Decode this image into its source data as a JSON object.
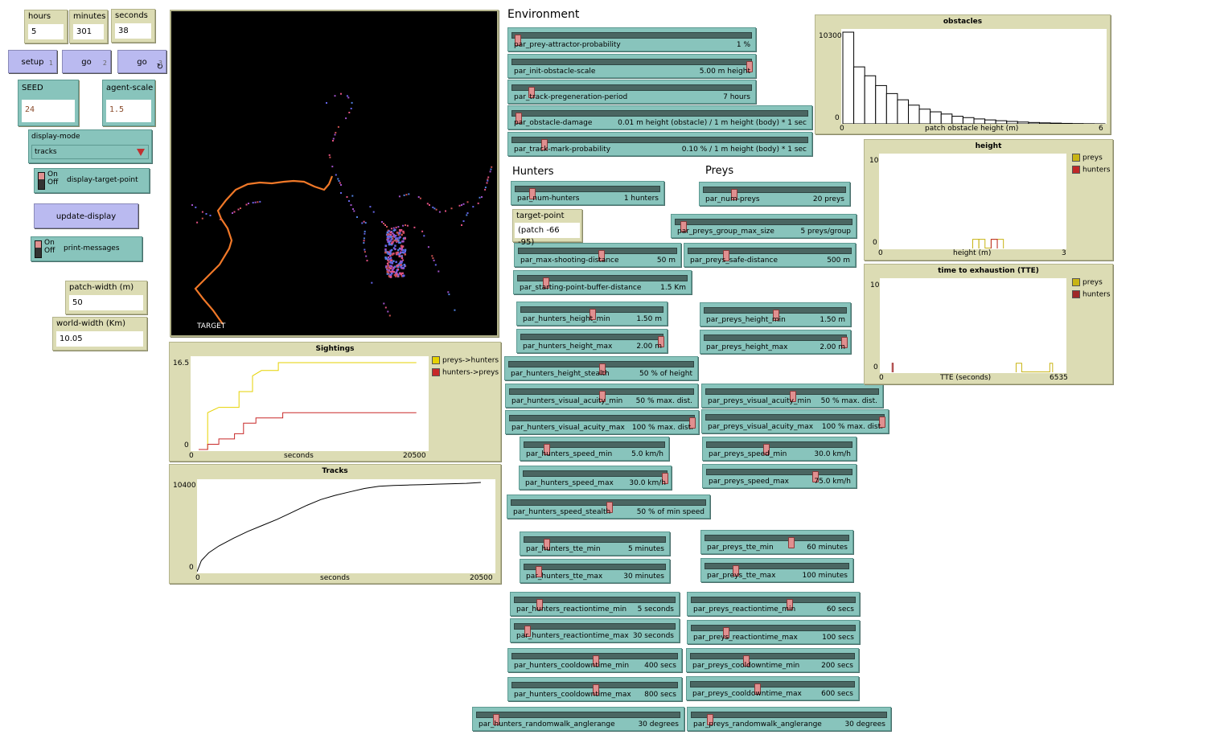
{
  "monitors": {
    "hours": {
      "label": "hours",
      "value": "5"
    },
    "minutes": {
      "label": "minutes",
      "value": "301"
    },
    "seconds": {
      "label": "seconds",
      "value": "38"
    },
    "patch_width": {
      "label": "patch-width (m)",
      "value": "50"
    },
    "world_width": {
      "label": "world-width (Km)",
      "value": "10.05"
    },
    "target_point": {
      "label": "target-point",
      "value": "(patch -66 -95)"
    }
  },
  "buttons": {
    "setup": {
      "label": "setup",
      "key": "1"
    },
    "go_once": {
      "label": "go",
      "key": "2"
    },
    "go_forever": {
      "label": "go",
      "key": "3"
    },
    "update_display": {
      "label": "update-display"
    }
  },
  "inputs": {
    "seed": {
      "label": "SEED",
      "value": "24"
    },
    "agent_scale": {
      "label": "agent-scale",
      "value": "1.5"
    }
  },
  "chooser": {
    "label": "display-mode",
    "value": "tracks"
  },
  "switches": {
    "display_target_point": {
      "label": "display-target-point",
      "on": "On",
      "off": "Off"
    },
    "print_messages": {
      "label": "print-messages",
      "on": "On",
      "off": "Off"
    }
  },
  "sections": {
    "environment": "Environment",
    "hunters": "Hunters",
    "preys": "Preys"
  },
  "view": {
    "target_label": "TARGET"
  },
  "sliders": {
    "prey_attractor": {
      "name": "par_prey-attractor-probability",
      "value": "1 %",
      "fraction": 0.01
    },
    "init_obstacle_scale": {
      "name": "par_init-obstacle-scale",
      "value": "5.00 m height",
      "fraction": 1.0
    },
    "track_pregeneration": {
      "name": "par_track-pregeneration-period",
      "value": "7 hours",
      "fraction": 0.07
    },
    "obstacle_damage": {
      "name": "par_obstacle-damage",
      "value": "0.01 m height (obstacle) / 1 m height (body) * 1 sec",
      "fraction": 0.01
    },
    "track_mark": {
      "name": "par_track-mark-probability",
      "value": "0.10 % / 1 m height (body) * 1 sec",
      "fraction": 0.1
    },
    "num_hunters": {
      "name": "par_num-hunters",
      "value": "1 hunters",
      "fraction": 0.1
    },
    "num_preys": {
      "name": "par_num-preys",
      "value": "20 preys",
      "fraction": 0.2
    },
    "preys_group_max": {
      "name": "par_preys_group_max_size",
      "value": "5 preys/group",
      "fraction": 0.03
    },
    "max_shooting": {
      "name": "par_max-shooting-distance",
      "value": "50 m",
      "fraction": 0.52
    },
    "preys_safe": {
      "name": "par_preys_safe-distance",
      "value": "500 m",
      "fraction": 0.22
    },
    "starting_buffer": {
      "name": "par_starting-point-buffer-distance",
      "value": "1.5 Km",
      "fraction": 0.15
    },
    "h_height_min": {
      "name": "par_hunters_height_min",
      "value": "1.50 m",
      "fraction": 0.5
    },
    "h_height_max": {
      "name": "par_hunters_height_max",
      "value": "2.00 m",
      "fraction": 1.0
    },
    "h_height_stealth": {
      "name": "par_hunters_height_stealth",
      "value": "50 % of height",
      "fraction": 0.5
    },
    "h_visual_min": {
      "name": "par_hunters_visual_acuity_min",
      "value": "50 % max. dist.",
      "fraction": 0.5
    },
    "h_visual_max": {
      "name": "par_hunters_visual_acuity_max",
      "value": "100 % max. dist.",
      "fraction": 1.0
    },
    "h_speed_min": {
      "name": "par_hunters_speed_min",
      "value": "5.0 km/h",
      "fraction": 0.14
    },
    "h_speed_max": {
      "name": "par_hunters_speed_max",
      "value": "30.0 km/h",
      "fraction": 1.0
    },
    "h_speed_stealth": {
      "name": "par_hunters_speed_stealth",
      "value": "50 % of min speed",
      "fraction": 0.5
    },
    "h_tte_min": {
      "name": "par_hunters_tte_min",
      "value": "5 minutes",
      "fraction": 0.14
    },
    "h_tte_max": {
      "name": "par_hunters_tte_max",
      "value": "30 minutes",
      "fraction": 0.08
    },
    "h_react_min": {
      "name": "par_hunters_reactiontime_min",
      "value": "5 seconds",
      "fraction": 0.14
    },
    "h_react_max": {
      "name": "par_hunters_reactiontime_max",
      "value": "30 seconds",
      "fraction": 0.06
    },
    "h_cool_min": {
      "name": "par_hunters_cooldowntime_min",
      "value": "400 secs",
      "fraction": 0.5
    },
    "h_cool_max": {
      "name": "par_hunters_cooldowntime_max",
      "value": "800 secs",
      "fraction": 0.5
    },
    "h_randomwalk": {
      "name": "par_hunters_randomwalk_anglerange",
      "value": "30 degrees",
      "fraction": 0.08
    },
    "p_height_min": {
      "name": "par_preys_height_min",
      "value": "1.50 m",
      "fraction": 0.5
    },
    "p_height_max": {
      "name": "par_preys_height_max",
      "value": "2.00 m",
      "fraction": 1.0
    },
    "p_visual_min": {
      "name": "par_preys_visual_acuity_min",
      "value": "50 % max. dist.",
      "fraction": 0.5
    },
    "p_visual_max": {
      "name": "par_preys_visual_acuity_max",
      "value": "100 % max. dist.",
      "fraction": 1.0
    },
    "p_speed_min": {
      "name": "par_preys_speed_min",
      "value": "30.0 km/h",
      "fraction": 0.4
    },
    "p_speed_max": {
      "name": "par_preys_speed_max",
      "value": "75.0 km/h",
      "fraction": 0.75
    },
    "p_tte_min": {
      "name": "par_preys_tte_min",
      "value": "60 minutes",
      "fraction": 0.6
    },
    "p_tte_max": {
      "name": "par_preys_tte_max",
      "value": "100 minutes",
      "fraction": 0.2
    },
    "p_react_min": {
      "name": "par_preys_reactiontime_min",
      "value": "60 secs",
      "fraction": 0.6
    },
    "p_react_max": {
      "name": "par_preys_reactiontime_max",
      "value": "100 secs",
      "fraction": 0.2
    },
    "p_cool_min": {
      "name": "par_preys_cooldowntime_min",
      "value": "200 secs",
      "fraction": 0.33
    },
    "p_cool_max": {
      "name": "par_preys_cooldowntime_max",
      "value": "600 secs",
      "fraction": 0.4
    },
    "p_randomwalk": {
      "name": "par_preys_randomwalk_anglerange",
      "value": "30 degrees",
      "fraction": 0.08
    }
  },
  "colors": {
    "preys": "#c8b414",
    "hunters": "#c02828",
    "sight_preys": "#e6d200",
    "sight_hunters": "#c82828"
  },
  "chart_data": [
    {
      "type": "line",
      "title": "Sightings",
      "xlabel": "seconds",
      "xlim": [
        0,
        20500
      ],
      "ylim": [
        0,
        16.5
      ],
      "x_ticks": [
        "0",
        "20500"
      ],
      "y_ticks": [
        "0",
        "16.5"
      ],
      "legend": "top-right",
      "series": [
        {
          "name": "preys->hunters",
          "color": "#e6d200",
          "points": [
            [
              0,
              0
            ],
            [
              800,
              0
            ],
            [
              800,
              7
            ],
            [
              1800,
              8
            ],
            [
              3600,
              8
            ],
            [
              3600,
              11
            ],
            [
              4800,
              11
            ],
            [
              4800,
              14
            ],
            [
              5600,
              15
            ],
            [
              7100,
              15
            ],
            [
              7100,
              16.5
            ],
            [
              19400,
              16.5
            ]
          ]
        },
        {
          "name": "hunters->preys",
          "color": "#c82828",
          "points": [
            [
              0,
              0
            ],
            [
              800,
              0
            ],
            [
              800,
              1
            ],
            [
              1800,
              1
            ],
            [
              1800,
              2
            ],
            [
              3200,
              2
            ],
            [
              3200,
              3
            ],
            [
              4000,
              3
            ],
            [
              4000,
              5
            ],
            [
              5100,
              5
            ],
            [
              5100,
              6
            ],
            [
              7500,
              6
            ],
            [
              7500,
              7
            ],
            [
              19400,
              7
            ]
          ]
        }
      ]
    },
    {
      "type": "line",
      "title": "Tracks",
      "xlabel": "seconds",
      "xlim": [
        0,
        20500
      ],
      "ylim": [
        0,
        10400
      ],
      "x_ticks": [
        "0",
        "20500"
      ],
      "y_ticks": [
        "0",
        "10400"
      ],
      "series": [
        {
          "color": "#000000",
          "points": [
            [
              0,
              0
            ],
            [
              300,
              1300
            ],
            [
              800,
              2200
            ],
            [
              1500,
              3000
            ],
            [
              2500,
              3900
            ],
            [
              3500,
              4700
            ],
            [
              4500,
              5400
            ],
            [
              5500,
              6100
            ],
            [
              6500,
              6900
            ],
            [
              7500,
              7700
            ],
            [
              8500,
              8400
            ],
            [
              9500,
              8900
            ],
            [
              10500,
              9300
            ],
            [
              11500,
              9700
            ],
            [
              12500,
              9950
            ],
            [
              13500,
              10050
            ],
            [
              14500,
              10100
            ],
            [
              15500,
              10150
            ],
            [
              16500,
              10200
            ],
            [
              17500,
              10250
            ],
            [
              18500,
              10300
            ],
            [
              19500,
              10400
            ]
          ]
        }
      ]
    },
    {
      "type": "bar",
      "title": "obstacles",
      "xlabel": "patch obstacle height (m)",
      "xlim": [
        0,
        6
      ],
      "ylim": [
        0,
        10300
      ],
      "x_ticks": [
        "0",
        "6"
      ],
      "y_ticks": [
        "0",
        "10300"
      ],
      "bin_width": 0.25,
      "values": [
        10300,
        6400,
        5400,
        4300,
        3400,
        2700,
        2100,
        1650,
        1350,
        1100,
        850,
        700,
        550,
        440,
        350,
        270,
        200,
        150,
        110,
        80,
        50,
        30,
        15,
        5
      ]
    },
    {
      "type": "bar",
      "title": "height",
      "xlabel": "height (m)",
      "xlim": [
        0,
        3
      ],
      "ylim": [
        0,
        10
      ],
      "x_ticks": [
        "0",
        "3"
      ],
      "y_ticks": [
        "0",
        "10"
      ],
      "legend": "top-right",
      "series": [
        {
          "name": "preys",
          "color": "#c8b414",
          "bins": [
            [
              1.5,
              1.6,
              1
            ],
            [
              1.6,
              1.7,
              1
            ],
            [
              1.7,
              1.8,
              0
            ],
            [
              1.8,
              1.9,
              1
            ],
            [
              1.9,
              2.0,
              1
            ]
          ]
        },
        {
          "name": "hunters",
          "color": "#c02828",
          "bins": [
            [
              1.8,
              1.9,
              1
            ]
          ]
        }
      ]
    },
    {
      "type": "bar",
      "title": "time to exhaustion (TTE)",
      "xlabel": "TTE (seconds)",
      "xlim": [
        0,
        6535
      ],
      "ylim": [
        0,
        10
      ],
      "x_ticks": [
        "0",
        "6535"
      ],
      "y_ticks": [
        "0",
        "10"
      ],
      "legend": "top-right",
      "series": [
        {
          "name": "preys",
          "color": "#c8b414",
          "bins": [
            [
              4800,
              5000,
              1
            ],
            [
              5000,
              6000,
              0
            ],
            [
              6000,
              6100,
              1
            ]
          ]
        },
        {
          "name": "hunters",
          "color": "#a02828",
          "bins": [
            [
              380,
              420,
              1
            ]
          ]
        }
      ]
    }
  ]
}
